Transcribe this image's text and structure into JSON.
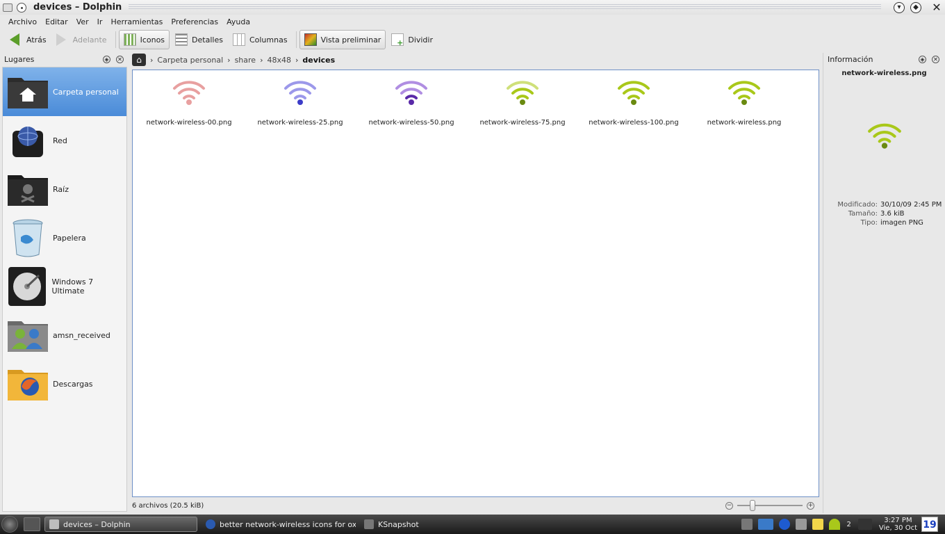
{
  "window": {
    "title": "devices – Dolphin"
  },
  "menu": [
    "Archivo",
    "Editar",
    "Ver",
    "Ir",
    "Herramientas",
    "Preferencias",
    "Ayuda"
  ],
  "toolbar": {
    "back": "Atrás",
    "forward": "Adelante",
    "icons": "Iconos",
    "details": "Detalles",
    "columns": "Columnas",
    "preview": "Vista preliminar",
    "split": "Dividir"
  },
  "places": {
    "title": "Lugares",
    "items": [
      {
        "label": "Carpeta personal",
        "icon": "home-folder-icon",
        "selected": true
      },
      {
        "label": "Red",
        "icon": "network-icon"
      },
      {
        "label": "Raíz",
        "icon": "root-folder-icon"
      },
      {
        "label": "Papelera",
        "icon": "trash-icon"
      },
      {
        "label": "Windows 7 Ultimate",
        "icon": "hard-drive-icon"
      },
      {
        "label": "amsn_received",
        "icon": "users-folder-icon"
      },
      {
        "label": "Descargas",
        "icon": "downloads-folder-icon"
      }
    ]
  },
  "breadcrumb": [
    "Carpeta personal",
    "share",
    "48x48",
    "devices"
  ],
  "files": [
    {
      "name": "network-wireless-00.png",
      "color": "#e8a0a0",
      "dot": "#e8a0a0"
    },
    {
      "name": "network-wireless-25.png",
      "color": "#9c98ea",
      "dot": "#3c3cc8"
    },
    {
      "name": "network-wireless-50.png",
      "color": "#b08ee2",
      "dot": "#5a2aa8"
    },
    {
      "name": "network-wireless-75.png",
      "color": "#cfe07a",
      "dot": "#6a8a10"
    },
    {
      "name": "network-wireless-100.png",
      "color": "#a9c81a",
      "dot": "#6a8a10"
    },
    {
      "name": "network-wireless.png",
      "color": "#a9c81a",
      "dot": "#6a8a10"
    }
  ],
  "status": {
    "text": "6 archivos (20.5 kiB)",
    "zoom": 0.2
  },
  "info": {
    "title": "Información",
    "filename": "network-wireless.png",
    "modified_label": "Modificado:",
    "modified_value": "30/10/09 2:45 PM",
    "size_label": "Tamaño:",
    "size_value": "3.6 kiB",
    "type_label": "Tipo:",
    "type_value": "imagen PNG"
  },
  "taskbar": {
    "tasks": [
      {
        "label": "devices – Dolphin",
        "active": true
      },
      {
        "label": "better network-wireless icons for oxyge",
        "active": false
      },
      {
        "label": "KSnapshot",
        "active": false
      }
    ],
    "pager": "2",
    "clock_time": "3:27 PM",
    "clock_date": "Vie, 30 Oct",
    "calendar_day": "19"
  }
}
